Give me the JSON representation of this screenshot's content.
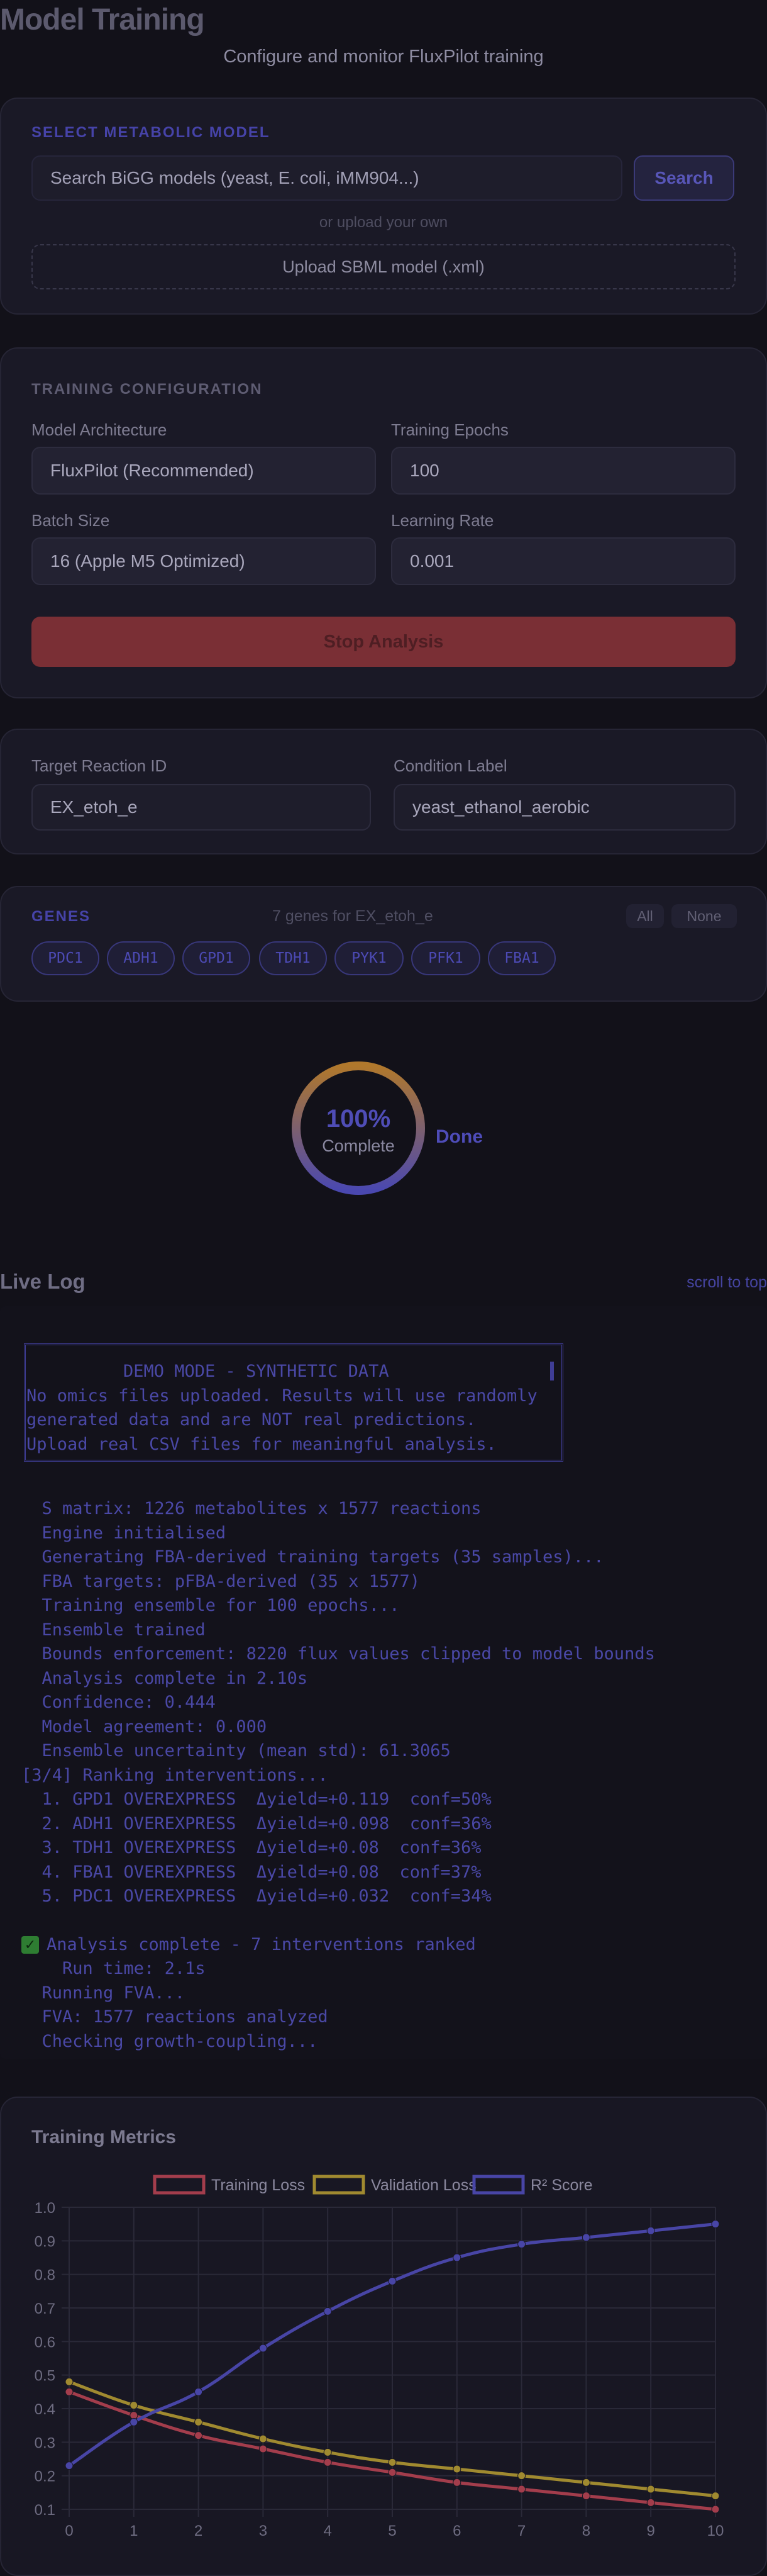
{
  "header": {
    "title": "Model Training",
    "subtitle": "Configure and monitor FluxPilot training"
  },
  "model_select": {
    "section_label": "SELECT METABOLIC MODEL",
    "search_placeholder": "Search BiGG models (yeast, E. coli, iMM904...)",
    "search_button": "Search",
    "or_text": "or upload your own",
    "upload_label": "Upload SBML model (.xml)"
  },
  "training_config": {
    "section_label": "TRAINING CONFIGURATION",
    "architecture_label": "Model Architecture",
    "architecture_value": "FluxPilot (Recommended)",
    "epochs_label": "Training Epochs",
    "epochs_value": "100",
    "batch_label": "Batch Size",
    "batch_value": "16 (Apple M5 Optimized)",
    "lr_label": "Learning Rate",
    "lr_value": "0.001",
    "stop_button": "Stop Analysis"
  },
  "target": {
    "reaction_label": "Target Reaction ID",
    "reaction_value": "EX_etoh_e",
    "condition_label": "Condition Label",
    "condition_value": "yeast_ethanol_aerobic"
  },
  "genes": {
    "section_label": "GENES",
    "summary": "7 genes for EX_etoh_e",
    "all_label": "All",
    "none_label": "None",
    "items": [
      "PDC1",
      "ADH1",
      "GPD1",
      "TDH1",
      "PYK1",
      "PFK1",
      "FBA1"
    ]
  },
  "progress": {
    "percent_text": "100%",
    "percent_value": 100,
    "status_text": "Complete",
    "done_text": "Done"
  },
  "log": {
    "title": "Live Log",
    "scroll_label": "scroll to top",
    "demo_box": [
      "DEMO MODE - SYNTHETIC DATA",
      "No omics files uploaded. Results will use randomly",
      "generated data and are NOT real predictions.",
      "Upload real CSV files for meaningful analysis."
    ],
    "lines": [
      "  S matrix: 1226 metabolites x 1577 reactions",
      "  Engine initialised",
      "  Generating FBA-derived training targets (35 samples)...",
      "  FBA targets: pFBA-derived (35 x 1577)",
      "  Training ensemble for 100 epochs...",
      "  Ensemble trained",
      "  Bounds enforcement: 8220 flux values clipped to model bounds",
      "  Analysis complete in 2.10s",
      "  Confidence: 0.444",
      "  Model agreement: 0.000",
      "  Ensemble uncertainty (mean std): 61.3065",
      "[3/4] Ranking interventions...",
      "  1. GPD1 OVEREXPRESS  Δyield=+0.119  conf=50%",
      "  2. ADH1 OVEREXPRESS  Δyield=+0.098  conf=36%",
      "  3. TDH1 OVEREXPRESS  Δyield=+0.08  conf=36%",
      "  4. FBA1 OVEREXPRESS  Δyield=+0.08  conf=37%",
      "  5. PDC1 OVEREXPRESS  Δyield=+0.032  conf=34%"
    ],
    "complete_line": "Analysis complete - 7 interventions ranked",
    "tail_lines": [
      "    Run time: 2.1s",
      "  Running FVA...",
      "  FVA: 1577 reactions analyzed",
      "  Checking growth-coupling..."
    ]
  },
  "metrics": {
    "title": "Training Metrics"
  },
  "chart_data": {
    "type": "line",
    "title": "",
    "xlabel": "",
    "ylabel": "",
    "x": [
      0,
      1,
      2,
      3,
      4,
      5,
      6,
      7,
      8,
      9,
      10
    ],
    "ylim": [
      0.1,
      1.0
    ],
    "yticks": [
      "0.1",
      "0.2",
      "0.3",
      "0.4",
      "0.5",
      "0.6",
      "0.7",
      "0.8",
      "0.9",
      "1.0"
    ],
    "xticks": [
      "0",
      "1",
      "2",
      "3",
      "4",
      "5",
      "6",
      "7",
      "8",
      "9",
      "10"
    ],
    "grid": true,
    "legend_position": "top-center",
    "series": [
      {
        "name": "Training Loss",
        "color": "#a33d4c",
        "values": [
          0.45,
          0.38,
          0.32,
          0.28,
          0.24,
          0.21,
          0.18,
          0.16,
          0.14,
          0.12,
          0.1
        ]
      },
      {
        "name": "Validation Loss",
        "color": "#a08a30",
        "values": [
          0.48,
          0.41,
          0.36,
          0.31,
          0.27,
          0.24,
          0.22,
          0.2,
          0.18,
          0.16,
          0.14
        ]
      },
      {
        "name": "R² Score",
        "color": "#4845a6",
        "values": [
          0.23,
          0.36,
          0.45,
          0.58,
          0.69,
          0.78,
          0.85,
          0.89,
          0.91,
          0.93,
          0.95
        ]
      }
    ]
  },
  "colors": {
    "accent": "#4e4cb8",
    "ring_gradient_start": "#4a48b0",
    "ring_gradient_end": "#b0782c",
    "stop_button": "#7a2f35",
    "background": "#121119"
  }
}
